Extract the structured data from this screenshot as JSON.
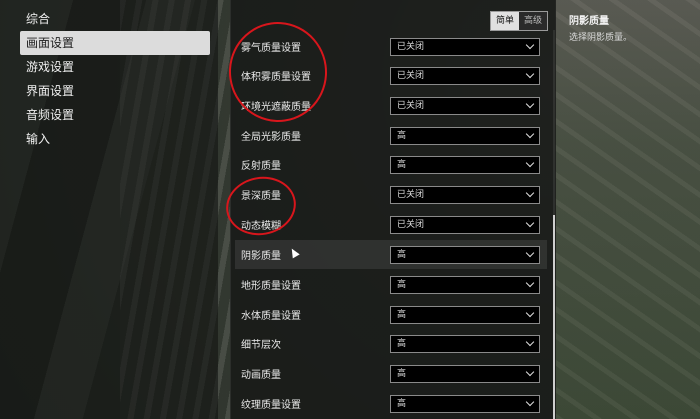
{
  "sidebar": {
    "items": [
      {
        "label": "综合"
      },
      {
        "label": "画面设置",
        "active": true
      },
      {
        "label": "游戏设置"
      },
      {
        "label": "界面设置"
      },
      {
        "label": "音频设置"
      },
      {
        "label": "输入"
      }
    ]
  },
  "mode_toggle": {
    "simple": "简单",
    "advanced": "高级",
    "selected": "简单"
  },
  "settings": [
    {
      "label": "雾气质量设置",
      "value": "已关闭"
    },
    {
      "label": "体积雾质量设置",
      "value": "已关闭"
    },
    {
      "label": "环境光遮蔽质量",
      "value": "已关闭"
    },
    {
      "label": "全局光影质量",
      "value": "高"
    },
    {
      "label": "反射质量",
      "value": "高"
    },
    {
      "label": "景深质量",
      "value": "已关闭"
    },
    {
      "label": "动态模糊",
      "value": "已关闭"
    },
    {
      "label": "阴影质量",
      "value": "高"
    },
    {
      "label": "地形质量设置",
      "value": "高"
    },
    {
      "label": "水体质量设置",
      "value": "高"
    },
    {
      "label": "细节层次",
      "value": "高"
    },
    {
      "label": "动画质量",
      "value": "高"
    },
    {
      "label": "纹理质量设置",
      "value": "高"
    }
  ],
  "description": {
    "title": "阴影质量",
    "text": "选择阴影质量。"
  },
  "annotation_color": "#d8161c"
}
